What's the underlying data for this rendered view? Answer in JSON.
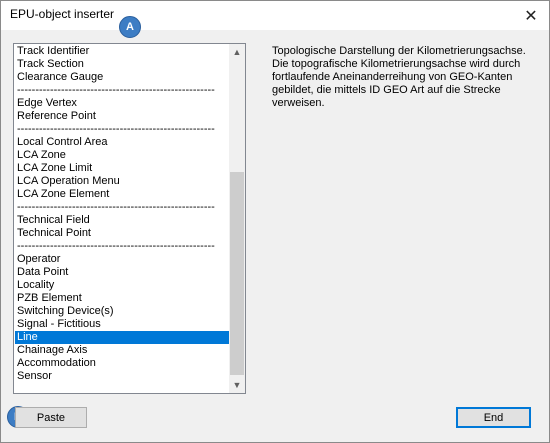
{
  "window": {
    "title": "EPU-object inserter",
    "close_glyph": "✕"
  },
  "markers": {
    "a": "A",
    "b": "B"
  },
  "list": {
    "items": [
      {
        "label": "Track Identifier",
        "selected": false
      },
      {
        "label": "Track Section",
        "selected": false
      },
      {
        "label": "Clearance Gauge",
        "selected": false
      },
      {
        "label": "------------------------------------------------------",
        "selected": false
      },
      {
        "label": "Edge Vertex",
        "selected": false
      },
      {
        "label": "Reference Point",
        "selected": false
      },
      {
        "label": "------------------------------------------------------",
        "selected": false
      },
      {
        "label": "Local Control Area",
        "selected": false
      },
      {
        "label": "LCA Zone",
        "selected": false
      },
      {
        "label": "LCA Zone Limit",
        "selected": false
      },
      {
        "label": "LCA Operation Menu",
        "selected": false
      },
      {
        "label": "LCA Zone Element",
        "selected": false
      },
      {
        "label": "------------------------------------------------------",
        "selected": false
      },
      {
        "label": "Technical Field",
        "selected": false
      },
      {
        "label": "Technical Point",
        "selected": false
      },
      {
        "label": "------------------------------------------------------",
        "selected": false
      },
      {
        "label": "Operator",
        "selected": false
      },
      {
        "label": "Data Point",
        "selected": false
      },
      {
        "label": "Locality",
        "selected": false
      },
      {
        "label": "PZB Element",
        "selected": false
      },
      {
        "label": "Switching Device(s)",
        "selected": false
      },
      {
        "label": "Signal - Fictitious",
        "selected": false
      },
      {
        "label": "Line",
        "selected": true
      },
      {
        "label": "Chainage Axis",
        "selected": false
      },
      {
        "label": "Accommodation",
        "selected": false
      },
      {
        "label": "Sensor",
        "selected": false
      }
    ],
    "scroll_up_glyph": "▲",
    "scroll_down_glyph": "▼"
  },
  "description": "Topologische Darstellung der Kilometrierungsachse. Die topografische Kilometrierungsachse wird durch fortlaufende Aneinanderreihung von GEO-Kanten gebildet, die mittels ID GEO Art auf die Strecke verweisen.",
  "buttons": {
    "paste": "Paste",
    "end": "End"
  },
  "colors": {
    "selection": "#0078d7",
    "marker": "#3d7dc4"
  }
}
